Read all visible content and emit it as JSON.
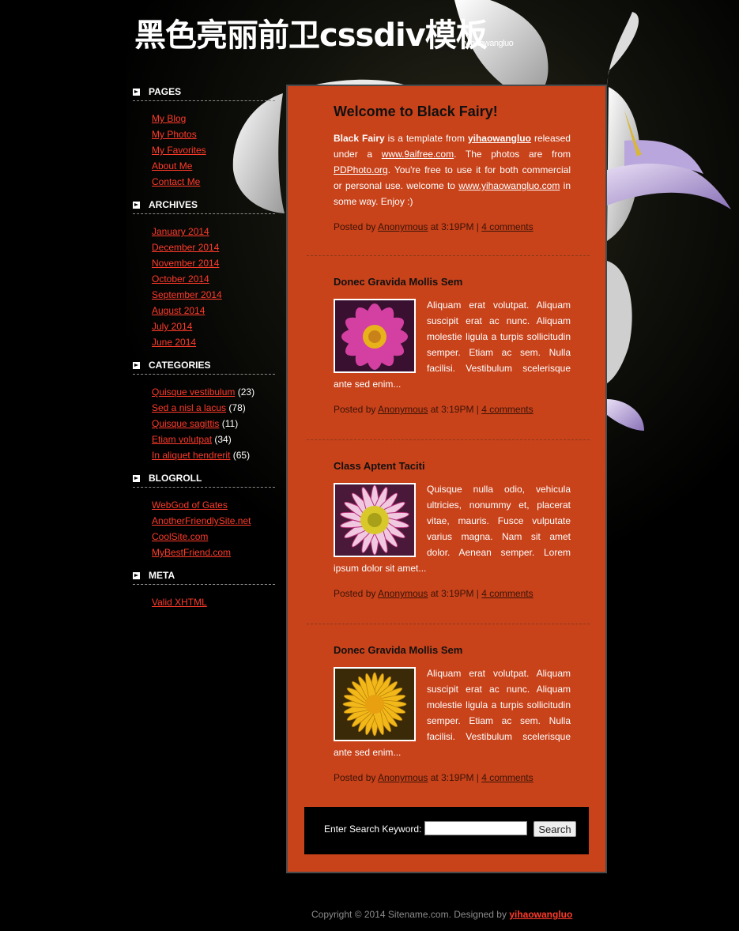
{
  "site": {
    "title": "黑色亮丽前卫cssdiv模板",
    "subtitle": "yihaowangluo"
  },
  "sidebar": {
    "pages": {
      "title": "PAGES",
      "items": [
        "My Blog",
        "My Photos",
        "My Favorites",
        "About Me",
        "Contact Me"
      ]
    },
    "archives": {
      "title": "ARCHIVES",
      "items": [
        "January 2014",
        "December 2014",
        "November 2014",
        "October 2014",
        "September 2014",
        "August 2014",
        "July 2014",
        "June 2014"
      ]
    },
    "categories": {
      "title": "CATEGORIES",
      "items": [
        {
          "label": "Quisque vestibulum",
          "count": "(23)"
        },
        {
          "label": "Sed a nisl a lacus",
          "count": "(78)"
        },
        {
          "label": "Quisque sagittis",
          "count": "(11)"
        },
        {
          "label": "Etiam volutpat",
          "count": "(34)"
        },
        {
          "label": "In aliquet hendrerit",
          "count": "(65)"
        }
      ]
    },
    "blogroll": {
      "title": "BLOGROLL",
      "items": [
        "WebGod of Gates",
        "AnotherFriendlySite.net",
        "CoolSite.com",
        "MyBestFriend.com"
      ]
    },
    "meta": {
      "title": "META",
      "items": [
        "Valid XHTML"
      ]
    }
  },
  "posts": [
    {
      "title": "Welcome to Black Fairy!",
      "intro_bold": "Black Fairy",
      "text1": " is a template from ",
      "link1": "yihaowangluo",
      "text2": " released under a ",
      "link2": "www.9aifree.com",
      "text3": ". The photos are from ",
      "link3": "PDPhoto.org",
      "text4": ". You're free to use it for both commercial or personal use. welcome to ",
      "link4": "www.yihaowangluo.com",
      "text5": " in some way. Enjoy :)",
      "meta": {
        "prefix": "Posted by ",
        "author": "Anonymous",
        "time": " at 3:19PM | ",
        "comments": "4 comments"
      }
    },
    {
      "title": "Donec Gravida Mollis Sem",
      "body": "Aliquam erat volutpat. Aliquam suscipit erat ac nunc. Aliquam molestie ligula a turpis sollicitudin semper. Etiam ac sem. Nulla facilisi. Vestibulum scelerisque ante sed enim...",
      "meta": {
        "prefix": "Posted by ",
        "author": "Anonymous",
        "time": " at 3:19PM | ",
        "comments": "4 comments"
      }
    },
    {
      "title": "Class Aptent Taciti",
      "body": "Quisque nulla odio, vehicula ultricies, nonummy et, placerat vitae, mauris. Fusce vulputate varius magna. Nam sit amet dolor. Aenean semper. Lorem ipsum dolor sit amet...",
      "meta": {
        "prefix": "Posted by ",
        "author": "Anonymous",
        "time": " at 3:19PM | ",
        "comments": "4 comments"
      }
    },
    {
      "title": "Donec Gravida Mollis Sem",
      "body": "Aliquam erat volutpat. Aliquam suscipit erat ac nunc. Aliquam molestie ligula a turpis sollicitudin semper. Etiam ac sem. Nulla facilisi. Vestibulum scelerisque ante sed enim...",
      "meta": {
        "prefix": "Posted by ",
        "author": "Anonymous",
        "time": " at 3:19PM | ",
        "comments": "4 comments"
      }
    }
  ],
  "search": {
    "label": "Enter Search Keyword:",
    "value": "",
    "button": "Search"
  },
  "footer": {
    "text": "Copyright © 2014 Sitename.com. Designed by ",
    "link": "yihaowangluo"
  },
  "colors": {
    "content_bg": "#c8421a",
    "link_red": "#ff3b2a",
    "page_bg": "#000000"
  }
}
